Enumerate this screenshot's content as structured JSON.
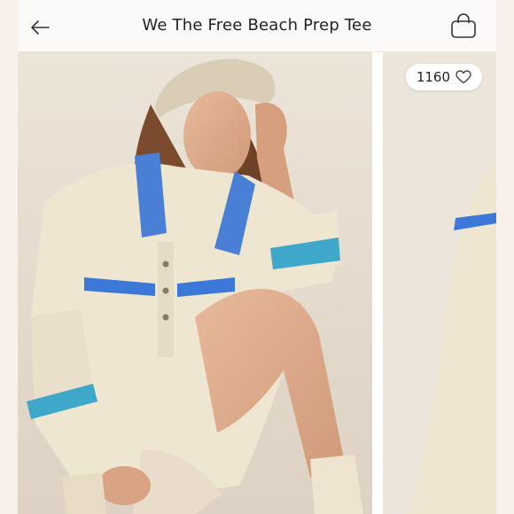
{
  "header": {
    "title": "We The Free Beach Prep Tee",
    "back_icon": "arrow-left-icon",
    "bag_icon": "shopping-bag-icon"
  },
  "likes": {
    "count": "1160",
    "icon": "heart-outline-icon"
  },
  "colors": {
    "header_bg": "#fbfaf8",
    "shirt": "#efe6d2",
    "stripe_blue": "#3c78d8",
    "collar_blue": "#4a7fd6",
    "cuff_teal": "#3fa7c9",
    "backdrop": "#e9e1d6"
  }
}
